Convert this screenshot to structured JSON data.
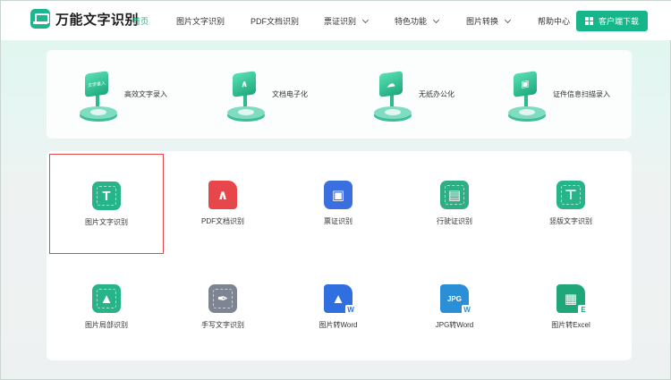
{
  "brand": {
    "name": "万能文字识别",
    "color": "#17b58a"
  },
  "nav": {
    "items": [
      {
        "label": "首页",
        "active": true
      },
      {
        "label": "图片文字识别"
      },
      {
        "label": "PDF文档识别"
      },
      {
        "label": "票证识别",
        "dropdown": true
      },
      {
        "label": "特色功能",
        "dropdown": true
      },
      {
        "label": "图片转换",
        "dropdown": true
      },
      {
        "label": "帮助中心"
      }
    ],
    "download_label": "客户端下载"
  },
  "features": [
    {
      "label": "高效文字录入",
      "icon": "text-entry-icon",
      "badge": "文字录入"
    },
    {
      "label": "文档电子化",
      "icon": "pdf-icon"
    },
    {
      "label": "无纸办公化",
      "icon": "cloud-icon"
    },
    {
      "label": "证件信息扫描录入",
      "icon": "id-card-icon"
    }
  ],
  "tools": [
    {
      "label": "图片文字识别",
      "icon": "text-t-icon",
      "color": "#27b488",
      "selected": true
    },
    {
      "label": "PDF文档识别",
      "icon": "pdf-icon",
      "color": "#e7474a"
    },
    {
      "label": "票证识别",
      "icon": "id-portrait-icon",
      "color": "#3b6fe0"
    },
    {
      "label": "行驶证识别",
      "icon": "license-card-icon",
      "color": "#2fae86"
    },
    {
      "label": "竖版文字识别",
      "icon": "vertical-text-icon",
      "color": "#27b488"
    },
    {
      "label": "图片局部识别",
      "icon": "image-crop-icon",
      "color": "#27b488"
    },
    {
      "label": "手写文字识别",
      "icon": "handwriting-icon",
      "color": "#7d8592"
    },
    {
      "label": "图片转Word",
      "icon": "image-to-word-icon",
      "color": "#2f6fe0",
      "badge": "W"
    },
    {
      "label": "JPG转Word",
      "icon": "jpg-to-word-icon",
      "color": "#2a8fd6",
      "badge": "W",
      "caption": "JPG"
    },
    {
      "label": "图片转Excel",
      "icon": "image-to-excel-icon",
      "color": "#1fa77a",
      "badge": "E"
    }
  ]
}
